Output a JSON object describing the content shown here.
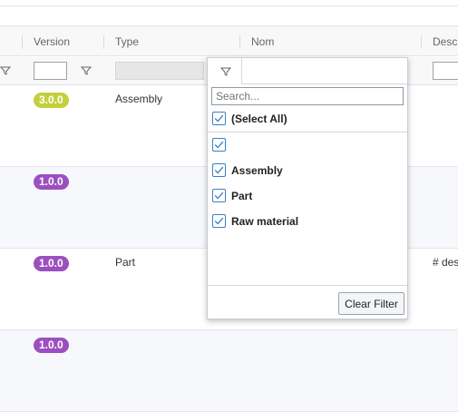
{
  "columns": {
    "version": "Version",
    "type": "Type",
    "nom": "Nom",
    "description": "Descr"
  },
  "filter_popup": {
    "search_placeholder": "Search...",
    "select_all_label": "(Select All)",
    "options": [
      {
        "label": "",
        "checked": true
      },
      {
        "label": "Assembly",
        "checked": true
      },
      {
        "label": "Part",
        "checked": true
      },
      {
        "label": "Raw material",
        "checked": true
      }
    ],
    "clear_filter_label": "Clear Filter"
  },
  "rows": [
    {
      "version": "3.0.0",
      "version_color": "#c3d03c",
      "type": "Assembly",
      "description": ""
    },
    {
      "version": "1.0.0",
      "version_color": "#9c4fbf",
      "type": "",
      "description": ""
    },
    {
      "version": "1.0.0",
      "version_color": "#9c4fbf",
      "type": "Part",
      "description": "# des"
    },
    {
      "version": "1.0.0",
      "version_color": "#9c4fbf",
      "type": "",
      "description": ""
    }
  ],
  "colors": {
    "checkbox_blue": "#3b7fc4",
    "badge_green": "#c3d03c",
    "badge_purple": "#9c4fbf"
  }
}
